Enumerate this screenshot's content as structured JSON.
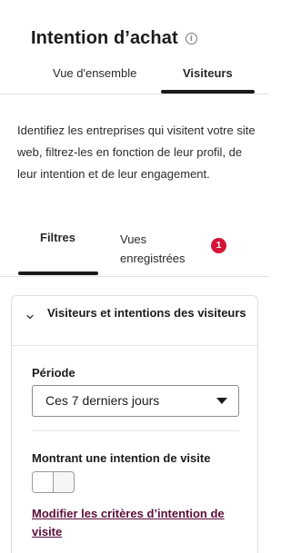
{
  "header": {
    "title": "Intention d’achat",
    "info_icon": "info-icon",
    "tabs": [
      {
        "label": "Vue d'ensemble",
        "active": false
      },
      {
        "label": "Visiteurs",
        "active": true
      }
    ]
  },
  "description": "Identifiez les entreprises qui visitent votre site web, filtrez-les en fonction de leur profil, de leur intention et de leur engagement.",
  "subtabs": {
    "filters_label": "Filtres",
    "saved_views_label": "Vues enregistrées",
    "saved_views_badge": "1"
  },
  "panel": {
    "title": "Visiteurs et intentions des visiteurs",
    "period_label": "Période",
    "period_value": "Ces 7 derniers jours",
    "intent_label": "Montrant une intention de visite",
    "intent_toggle_on": false,
    "modify_link": "Modifier les critères d’intention de visite"
  },
  "colors": {
    "badge": "#d3153a",
    "link": "#5b0d3a",
    "underline": "#1b1b1b"
  }
}
